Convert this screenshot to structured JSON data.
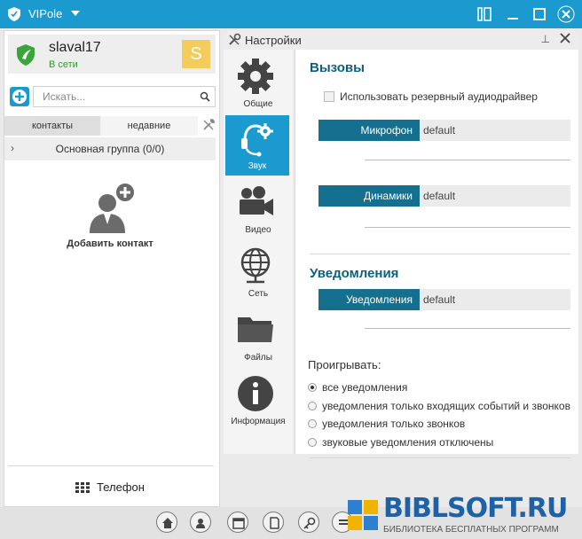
{
  "window": {
    "title": "VIPole"
  },
  "profile": {
    "name": "slaval17",
    "status": "В сети",
    "avatar_letter": "S"
  },
  "search": {
    "placeholder": "Искать..."
  },
  "contact_tabs": [
    {
      "label": "контакты"
    },
    {
      "label": "недавние"
    }
  ],
  "group": {
    "label": "Основная группа (0/0)"
  },
  "empty_state": {
    "add_contact_label": "Добавить контакт"
  },
  "phone": {
    "label": "Телефон"
  },
  "settings": {
    "title": "Настройки",
    "pin_glyph": "⊥",
    "nav": [
      {
        "label": "Общие",
        "icon": "gear-icon",
        "active": false
      },
      {
        "label": "Звук",
        "icon": "headset-icon",
        "active": true
      },
      {
        "label": "Видео",
        "icon": "video-camera-icon",
        "active": false
      },
      {
        "label": "Сеть",
        "icon": "globe-network-icon",
        "active": false
      },
      {
        "label": "Файлы",
        "icon": "folder-icon",
        "active": false
      },
      {
        "label": "Информация",
        "icon": "info-icon",
        "active": false
      }
    ],
    "calls": {
      "title": "Вызовы",
      "backup_driver_label": "Использовать резервный аудиодрайвер",
      "microphone": {
        "label": "Микрофон",
        "value": "default"
      },
      "speakers": {
        "label": "Динамики",
        "value": "default"
      }
    },
    "notifications": {
      "title": "Уведомления",
      "device": {
        "label": "Уведомления",
        "value": "default"
      },
      "play_label": "Проигрывать:",
      "options": [
        {
          "label": "все уведомления",
          "checked": true
        },
        {
          "label": "уведомления только входящих событий и звонков",
          "checked": false
        },
        {
          "label": "уведомления только звонков",
          "checked": false
        },
        {
          "label": "звуковые уведомления отключены",
          "checked": false
        }
      ]
    }
  },
  "watermark": {
    "main": "BIBLSOFT.RU",
    "sub": "БИБЛИОТЕКА БЕСПЛАТНЫХ ПРОГРАММ"
  },
  "colors": {
    "accent": "#1b9ad0",
    "dark_accent": "#15708f",
    "section_title": "#0d5f7e",
    "online": "#2e9b2e",
    "avatar": "#f4cc5c"
  }
}
